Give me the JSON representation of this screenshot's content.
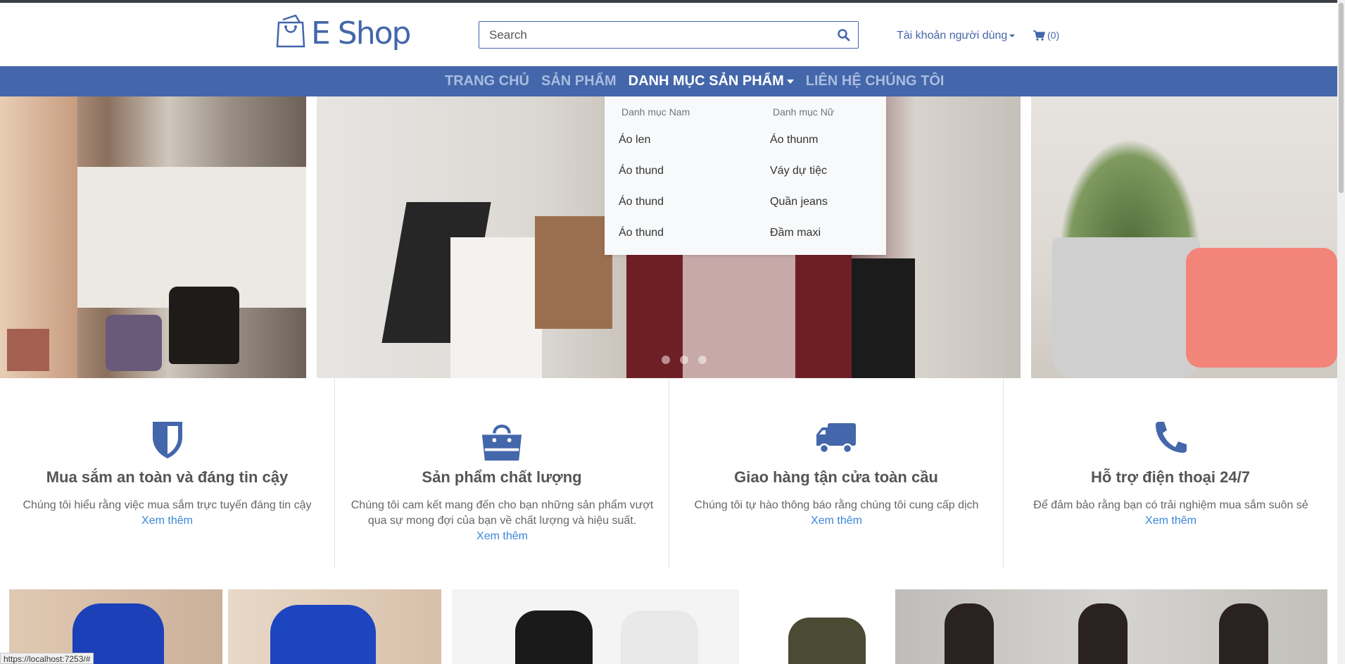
{
  "header": {
    "logo_text": "E Shop",
    "search_placeholder": "Search",
    "account_label": "Tài khoản người dùng",
    "cart_count": "(0)"
  },
  "nav": {
    "items": [
      {
        "label": "TRANG CHỦ"
      },
      {
        "label": "SẢN PHẨM"
      },
      {
        "label": "DANH MỤC SẢN PHẨM"
      },
      {
        "label": "LIÊN HỆ CHÚNG TÔI"
      }
    ]
  },
  "dropdown": {
    "men_header": "Danh mục Nam",
    "women_header": "Danh mục Nữ",
    "men_items": [
      "Áo len",
      "Áo thund",
      "Áo thund",
      "Áo thund"
    ],
    "women_items": [
      "Áo thunm",
      "Váy dự tiệc",
      "Quần jeans",
      "Đầm maxi"
    ]
  },
  "features": [
    {
      "title": "Mua sắm an toàn và đáng tin cậy",
      "text": "Chúng tôi hiểu rằng việc mua sắm trực tuyến đáng tin cậy",
      "link": "Xem thêm",
      "icon": "shield-icon"
    },
    {
      "title": "Sản phẩm chất lượng",
      "text": "Chúng tôi cam kết mang đến cho bạn những sản phẩm vượt qua sự mong đợi của bạn về chất lượng và hiệu suất.",
      "link": "Xem thêm",
      "icon": "shopping-bag-icon"
    },
    {
      "title": "Giao hàng tận cửa toàn cầu",
      "text": "Chúng tôi tự hào thông báo rằng chúng tôi cung cấp dịch",
      "link": "Xem thêm",
      "icon": "truck-icon"
    },
    {
      "title": "Hỗ trợ điện thoại 24/7",
      "text": "Để đảm bảo rằng bạn có trải nghiệm mua sắm suôn sẻ",
      "link": "Xem thêm",
      "icon": "phone-icon"
    }
  ],
  "status_url": "https://localhost:7253/#",
  "colors": {
    "brand": "#4466aa",
    "link": "#3a86d9",
    "nav_text": "#a9bde0"
  }
}
